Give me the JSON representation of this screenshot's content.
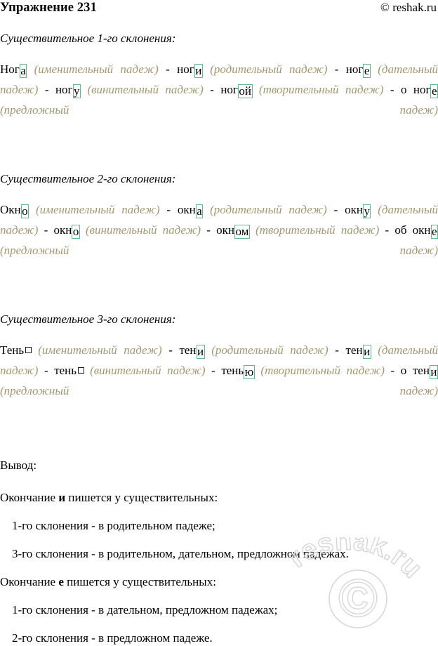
{
  "header": {
    "title": "Упражнение 231",
    "copyright": "© reshak.ru"
  },
  "sections": [
    {
      "heading": "Существительное 1-го склонения:",
      "forms": [
        {
          "stem": "Ног",
          "ending": "а",
          "zero": false,
          "case": "(именительный падеж)"
        },
        {
          "stem": "ног",
          "ending": "и",
          "zero": false,
          "case": "(родительный падеж)"
        },
        {
          "stem": "ног",
          "ending": "е",
          "zero": false,
          "case": "(дательный падеж)"
        },
        {
          "stem": "ног",
          "ending": "у",
          "zero": false,
          "case": "(винительный падеж)"
        },
        {
          "stem": "ног",
          "ending": "ой",
          "zero": false,
          "case": "(творительный падеж)"
        },
        {
          "stem": "о ног",
          "ending": "е",
          "zero": false,
          "case": "(предложный падеж)"
        }
      ]
    },
    {
      "heading": "Существительное 2-го склонения:",
      "forms": [
        {
          "stem": "Окн",
          "ending": "о",
          "zero": false,
          "case": "(именительный падеж)"
        },
        {
          "stem": "окн",
          "ending": "а",
          "zero": false,
          "case": "(родительный падеж)"
        },
        {
          "stem": "окн",
          "ending": "у",
          "zero": false,
          "case": "(дательный падеж)"
        },
        {
          "stem": "окн",
          "ending": "о",
          "zero": false,
          "case": "(винительный падеж)"
        },
        {
          "stem": "окн",
          "ending": "ом",
          "zero": false,
          "case": "(творительный падеж)"
        },
        {
          "stem": "об окн",
          "ending": "е",
          "zero": false,
          "case": "(предложный падеж)"
        }
      ]
    },
    {
      "heading": "Существительное 3-го склонения:",
      "forms": [
        {
          "stem": "Тень",
          "ending": "",
          "zero": true,
          "case": "(именительный падеж)"
        },
        {
          "stem": "тен",
          "ending": "и",
          "zero": false,
          "case": "(родительный падеж)"
        },
        {
          "stem": "тен",
          "ending": "и",
          "zero": false,
          "case": "(дательный падеж)"
        },
        {
          "stem": "тень",
          "ending": "",
          "zero": true,
          "case": "(винительный падеж)"
        },
        {
          "stem": "тень",
          "ending": "ю",
          "zero": false,
          "case": "(творительный падеж)"
        },
        {
          "stem": "о тен",
          "ending": "и",
          "zero": false,
          "case": "(предложный падеж)"
        }
      ]
    }
  ],
  "separator": "-",
  "conclusion": {
    "label": "Вывод:",
    "blocks": [
      {
        "rule_before": "Окончание ",
        "rule_letter": "и",
        "rule_after": " пишется у существительных:",
        "items": [
          "1-го склонения - в родительном падеже;",
          "3-го склонения - в родительном, дательном, предложном падежах."
        ]
      },
      {
        "rule_before": "Окончание ",
        "rule_letter": "е",
        "rule_after": " пишется у существительных:",
        "items": [
          "1-го склонения - в дательном, предложном падежах;",
          "2-го склонения - в предложном падеже."
        ]
      }
    ]
  },
  "watermark": {
    "text": "reshak.ru",
    "symbol": "©",
    "color": "#d5d5d5"
  },
  "colors": {
    "ending_box": "#57bd8c",
    "case_name": "#a2996f",
    "text": "#000000"
  }
}
